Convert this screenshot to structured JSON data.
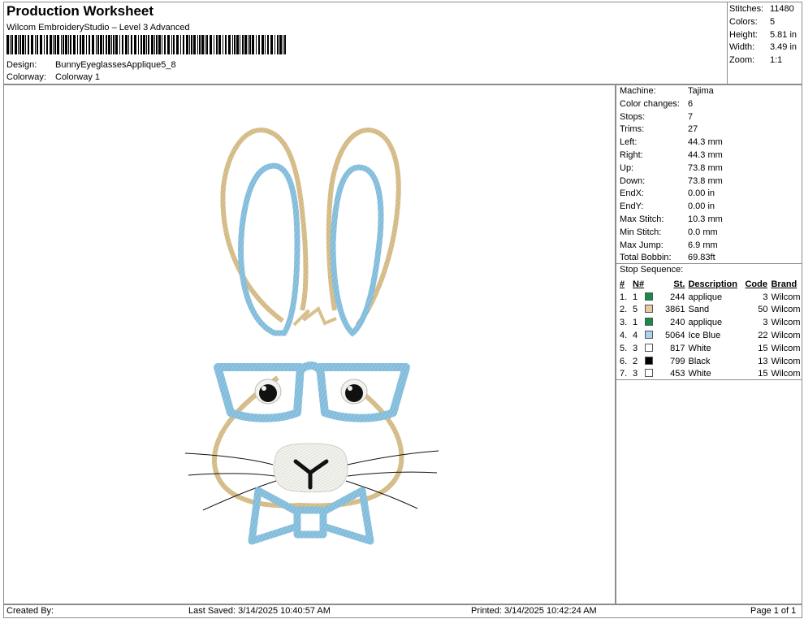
{
  "header": {
    "title": "Production Worksheet",
    "subtitle": "Wilcom EmbroideryStudio – Level 3 Advanced",
    "design_label": "Design:",
    "design_value": "BunnyEyeglassesApplique5_8",
    "colorway_label": "Colorway:",
    "colorway_value": "Colorway 1"
  },
  "stats": [
    {
      "label": "Stitches:",
      "value": "11480"
    },
    {
      "label": "Colors:",
      "value": "5"
    },
    {
      "label": "Height:",
      "value": "5.81 in"
    },
    {
      "label": "Width:",
      "value": "3.49 in"
    },
    {
      "label": "Zoom:",
      "value": "1:1"
    }
  ],
  "machine_info": [
    {
      "label": "Machine:",
      "value": "Tajima"
    },
    {
      "label": "Color changes:",
      "value": "6"
    },
    {
      "label": "Stops:",
      "value": "7"
    },
    {
      "label": "Trims:",
      "value": "27"
    },
    {
      "label": "Left:",
      "value": "44.3 mm"
    },
    {
      "label": "Right:",
      "value": "44.3 mm"
    },
    {
      "label": "Up:",
      "value": "73.8 mm"
    },
    {
      "label": "Down:",
      "value": "73.8 mm"
    },
    {
      "label": "EndX:",
      "value": "0.00 in"
    },
    {
      "label": "EndY:",
      "value": "0.00 in"
    },
    {
      "label": "Max Stitch:",
      "value": "10.3 mm"
    },
    {
      "label": "Min Stitch:",
      "value": "0.0 mm"
    },
    {
      "label": "Max Jump:",
      "value": "6.9 mm"
    },
    {
      "label": "Total Bobbin:",
      "value": "69.83ft"
    }
  ],
  "stop_sequence": {
    "title": "Stop Sequence:",
    "headers": [
      "#",
      "N#",
      "St.",
      "Description",
      "Code",
      "Brand"
    ],
    "rows": [
      {
        "num": "1.",
        "n": "1",
        "color": "#1a8a4a",
        "st": "244",
        "desc": "applique",
        "code": "3",
        "brand": "Wilcom"
      },
      {
        "num": "2.",
        "n": "5",
        "color": "#e8c9a0",
        "st": "3861",
        "desc": "Sand",
        "code": "50",
        "brand": "Wilcom"
      },
      {
        "num": "3.",
        "n": "1",
        "color": "#1a8a4a",
        "st": "240",
        "desc": "applique",
        "code": "3",
        "brand": "Wilcom"
      },
      {
        "num": "4.",
        "n": "4",
        "color": "#a9d2ee",
        "st": "5064",
        "desc": "Ice Blue",
        "code": "22",
        "brand": "Wilcom"
      },
      {
        "num": "5.",
        "n": "3",
        "color": "#ffffff",
        "st": "817",
        "desc": "White",
        "code": "15",
        "brand": "Wilcom"
      },
      {
        "num": "6.",
        "n": "2",
        "color": "#000000",
        "st": "799",
        "desc": "Black",
        "code": "13",
        "brand": "Wilcom"
      },
      {
        "num": "7.",
        "n": "3",
        "color": "#ffffff",
        "st": "453",
        "desc": "White",
        "code": "15",
        "brand": "Wilcom"
      }
    ]
  },
  "footer": {
    "created_by": "Created By:",
    "last_saved": "Last Saved: 3/14/2025 10:40:57 AM",
    "printed": "Printed: 3/14/2025 10:42:24 AM",
    "page": "Page 1 of 1"
  },
  "design_colors": {
    "sand": "#d8c08f",
    "ice_blue": "#8ec3df",
    "white_fill": "#f2f2ee",
    "black": "#111111"
  }
}
